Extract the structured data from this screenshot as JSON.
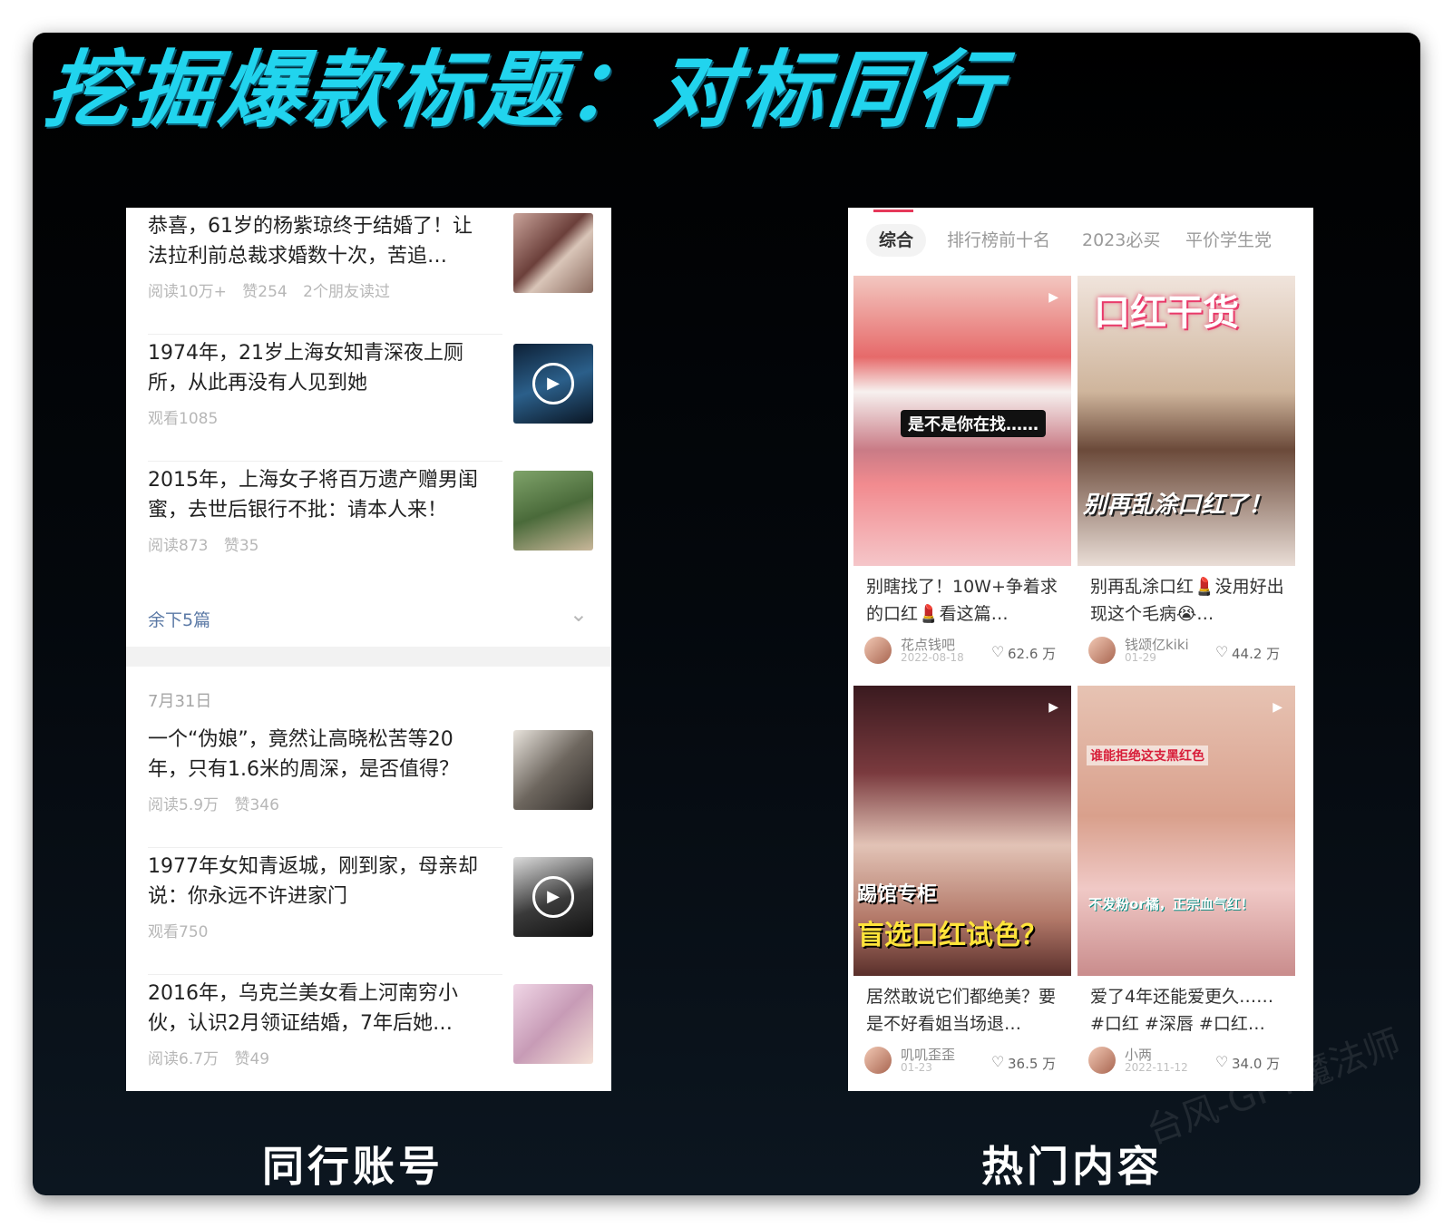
{
  "headline": "挖掘爆款标题：对标同行",
  "captions": {
    "left": "同行账号",
    "right": "热门内容"
  },
  "watermark": "台风-GPT魔法师",
  "left_panel": {
    "articles_top": [
      {
        "title": "恭喜，61岁的杨紫琼终于结婚了！让法拉利前总裁求婚数十次，苦追…",
        "meta": [
          "阅读10万+",
          "赞254",
          "2个朋友读过"
        ],
        "video": false
      },
      {
        "title": "1974年，21岁上海女知青深夜上厕所，从此再没有人见到她",
        "meta": [
          "观看1085"
        ],
        "video": true
      },
      {
        "title": "2015年，上海女子将百万遗产赠男闺蜜，去世后银行不批：请本人来！",
        "meta": [
          "阅读873",
          "赞35"
        ],
        "video": false
      }
    ],
    "more_label": "余下5篇",
    "date_label": "7月31日",
    "articles_bottom": [
      {
        "title": "一个“伪娘”，竟然让高晓松苦等20年，只有1.6米的周深，是否值得？",
        "meta": [
          "阅读5.9万",
          "赞346"
        ],
        "video": false
      },
      {
        "title": "1977年女知青返城，刚到家，母亲却说：你永远不许进家门",
        "meta": [
          "观看750"
        ],
        "video": true
      },
      {
        "title": "2016年，乌克兰美女看上河南穷小伙，认识2月领证结婚，7年后她…",
        "meta": [
          "阅读6.7万",
          "赞49"
        ],
        "video": false
      }
    ]
  },
  "right_panel": {
    "tabs": [
      "综合",
      "排行榜前十名",
      "2023必买",
      "平价学生党"
    ],
    "active_tab": "综合",
    "cards": [
      {
        "title": "别瞎找了！10W+争着求的口红💄看这篇…",
        "author": "花点钱吧",
        "date": "2022-08-18",
        "likes": "62.6 万",
        "overlay": "是不是你在找……"
      },
      {
        "title": "别再乱涂口红💄没用好出现这个毛病😭…",
        "author": "钱颂亿kiki",
        "date": "01-29",
        "likes": "44.2 万",
        "overlay_top": "口红干货",
        "overlay_bottom": "别再乱涂口红了！"
      },
      {
        "title": "居然敢说它们都绝美？要是不好看姐当场退…",
        "author": "叽叽歪歪",
        "date": "01-23",
        "likes": "36.5 万",
        "overlay_top": "踢馆专柜",
        "overlay_bottom": "盲选口红试色？"
      },
      {
        "title": "爱了4年还能爱更久……#口红 #深唇 #口红…",
        "author": "小两",
        "date": "2022-11-12",
        "likes": "34.0 万",
        "overlay_top": "谁能拒绝这支黑红色",
        "overlay_bottom": "不发粉or橘，正宗血气红！"
      }
    ]
  },
  "colors": {
    "headline": "#21d4ee",
    "accent": "#e6395a",
    "link": "#5c7aa6"
  }
}
